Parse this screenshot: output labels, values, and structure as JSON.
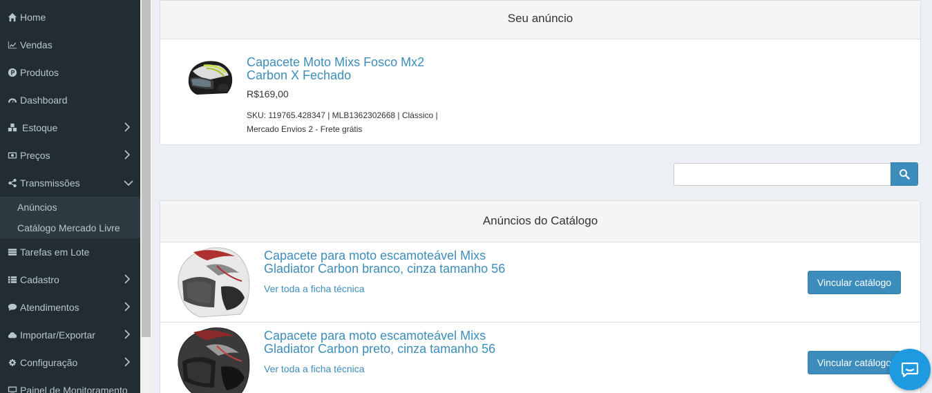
{
  "sidebar": {
    "items": [
      {
        "label": "Home",
        "icon": "home-icon"
      },
      {
        "label": "Vendas",
        "icon": "chart-line-icon"
      },
      {
        "label": "Produtos",
        "icon": "product-p-icon"
      },
      {
        "label": "Dashboard",
        "icon": "dashboard-icon"
      },
      {
        "label": "Estoque",
        "icon": "cubes-icon"
      },
      {
        "label": "Preços",
        "icon": "money-icon"
      },
      {
        "label": "Transmissões",
        "icon": "share-icon"
      },
      {
        "label": "Tarefas em Lote",
        "icon": "tasks-icon"
      },
      {
        "label": "Cadastro",
        "icon": "list-icon"
      },
      {
        "label": "Atendimentos",
        "icon": "comments-icon"
      },
      {
        "label": "Importar/Exportar",
        "icon": "cloud-icon"
      },
      {
        "label": "Configuração",
        "icon": "gear-icon"
      },
      {
        "label": "Painel de Monitoramento",
        "icon": "desktop-icon"
      }
    ],
    "submenu": [
      "Anúncios",
      "Catálogo Mercado Livre"
    ]
  },
  "your_ad": {
    "heading": "Seu anúncio",
    "title_line1": "Capacete Moto Mixs Fosco Mx2",
    "title_line2": "Carbon X Fechado",
    "price": "R$169,00",
    "meta_line1": "SKU: 119765.428347 | MLB1362302668 | Clássico |",
    "meta_line2": "Mercado Envios 2 - Frete grátis"
  },
  "search": {
    "placeholder": "",
    "value": ""
  },
  "catalog": {
    "heading": "Anúncios do Catálogo",
    "items": [
      {
        "title_line1": "Capacete para moto escamoteável Mixs",
        "title_line2": "Gladiator Carbon branco, cinza tamanho 56",
        "link": "Ver toda a ficha técnica",
        "button": "Vincular catálogo"
      },
      {
        "title_line1": "Capacete para moto escamoteável Mixs",
        "title_line2": "Gladiator Carbon preto, cinza tamanho 56",
        "link": "Ver toda a ficha técnica",
        "button": "Vincular catálogo"
      }
    ]
  },
  "colors": {
    "sidebar_bg": "#222d32",
    "accent": "#3c8dbc",
    "chat_widget": "#1e9be0"
  }
}
